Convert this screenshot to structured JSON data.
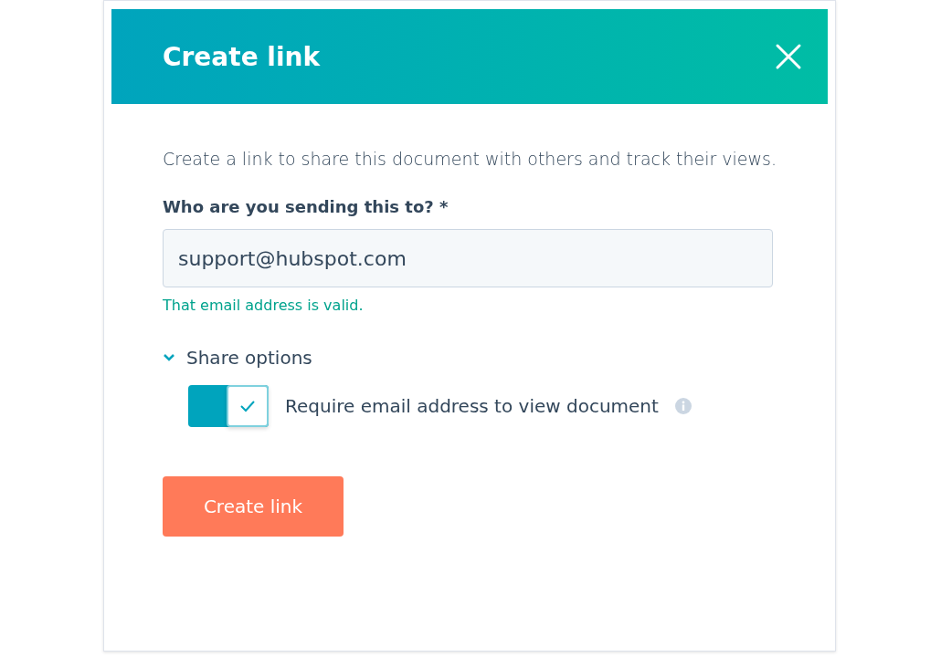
{
  "dialog": {
    "title": "Create link",
    "description": "Create a link to share this document with others and track their views.",
    "recipient": {
      "label": "Who are you sending this to? *",
      "value": "support@hubspot.com",
      "validation": "That email address is valid."
    },
    "share_options": {
      "label": "Share options",
      "expanded": true,
      "toggle": {
        "label": "Require email address to view document",
        "on": true
      }
    },
    "primary_button": "Create link"
  }
}
